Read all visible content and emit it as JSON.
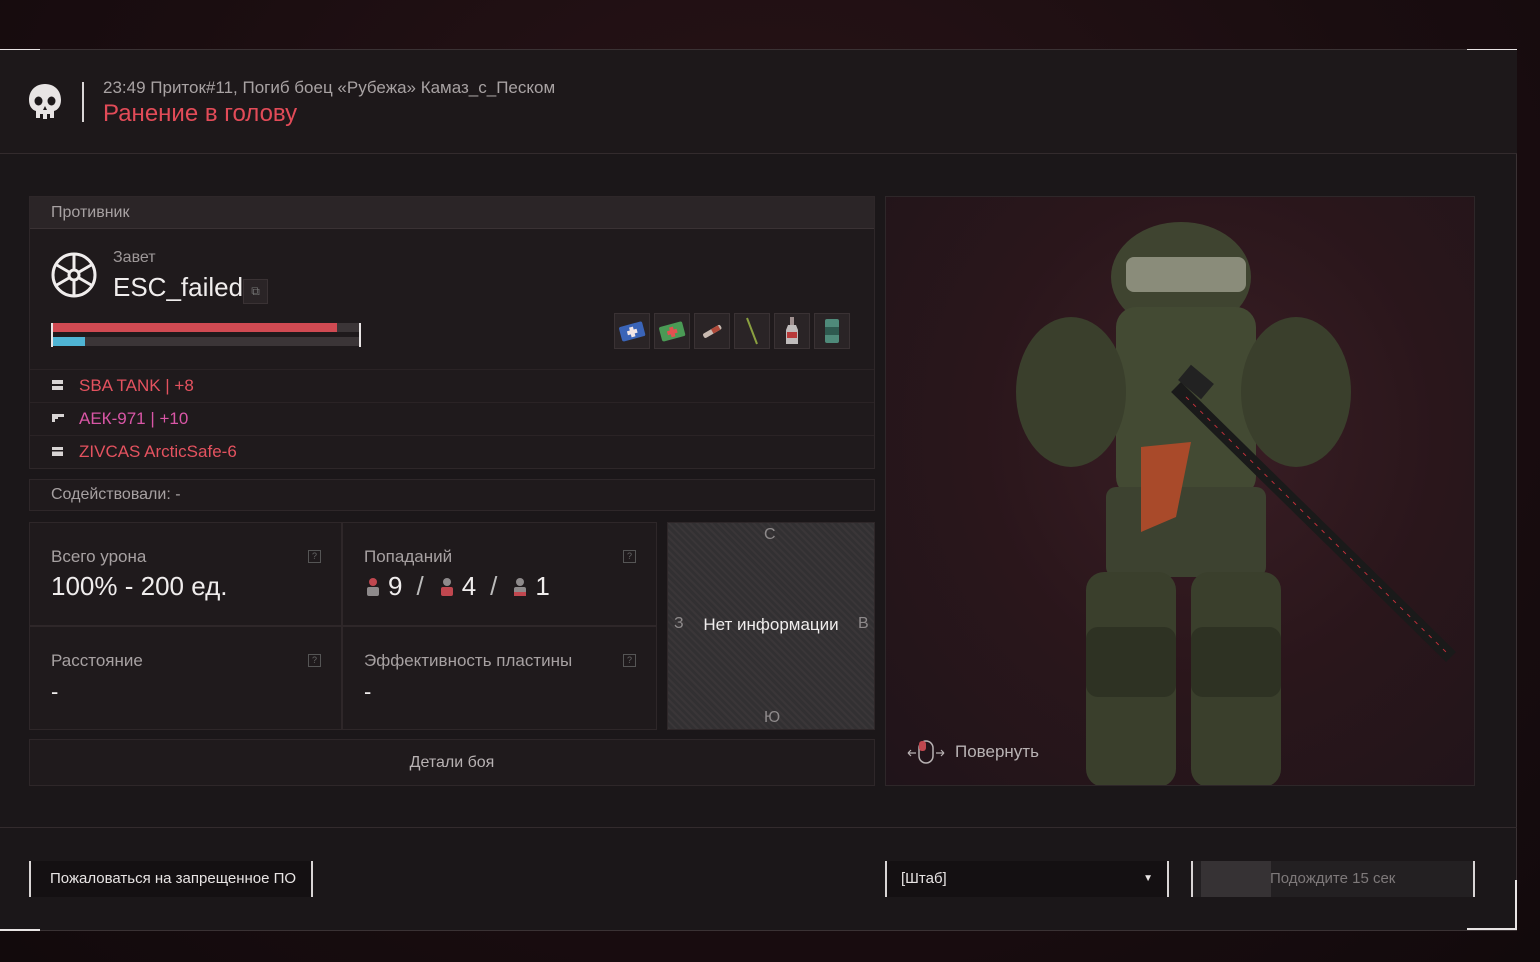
{
  "header": {
    "meta": "23:49 Приток#11, Погиб боец «Рубежа» Камаз_с_Песком",
    "title": "Ранение в голову"
  },
  "enemy": {
    "section_label": "Противник",
    "faction": "Завет",
    "name": "ESC_failed",
    "copy_icon": "copy-icon",
    "health_fraction": 0.93,
    "energy_fraction": 0.11,
    "items": [
      "medkit-blue-icon",
      "medkit-green-icon",
      "syringe-icon",
      "stick-icon",
      "bottle-icon",
      "can-icon"
    ],
    "equipment": [
      {
        "icon": "armor-icon",
        "label": "SBA TANK | +8",
        "color": "#e4525f"
      },
      {
        "icon": "rifle-icon",
        "label": "АЕК-971 | +10",
        "color": "#d956a6"
      },
      {
        "icon": "container-icon",
        "label": "ZIVCAS ArcticSafe-6",
        "color": "#e4525f"
      }
    ]
  },
  "assist": {
    "text": "Содействовали:  -"
  },
  "stats": {
    "damage_label": "Всего урона",
    "damage_value": "100% - 200 ед.",
    "hits_label": "Попаданий",
    "hits": [
      "9",
      "4",
      "1"
    ],
    "distance_label": "Расстояние",
    "distance_value": "-",
    "plate_label": "Эффективность пластины",
    "plate_value": "-"
  },
  "minimap": {
    "north": "С",
    "south": "Ю",
    "west": "З",
    "east": "В",
    "text": "Нет информации"
  },
  "details_button": "Детали боя",
  "model": {
    "rotate_label": "Повернуть"
  },
  "footer": {
    "report_button": "Пожаловаться на запрещенное ПО",
    "select_value": "[Штаб]",
    "wait_label": "Подождите 15 сек",
    "wait_progress": 0.25
  }
}
